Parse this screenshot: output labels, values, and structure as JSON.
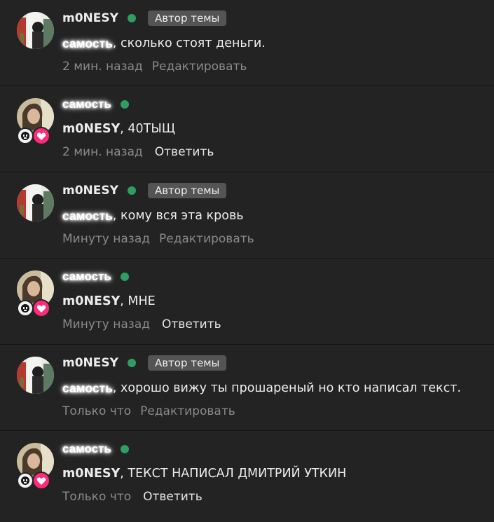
{
  "comments": [
    {
      "type": "author",
      "author": "m0NESY",
      "badge": "Автор темы",
      "mention": "самость",
      "text": ", сколько стоят деньги.",
      "time": "2 мин. назад",
      "action": "Редактировать"
    },
    {
      "type": "reply",
      "author": "самость",
      "mention": "m0NESY",
      "text": ", 40ТЫЩ",
      "time": "2 мин. назад",
      "action": "Ответить"
    },
    {
      "type": "author",
      "author": "m0NESY",
      "badge": "Автор темы",
      "mention": "самость",
      "text": ", кому вся эта кровь",
      "time": "Минуту назад",
      "action": "Редактировать"
    },
    {
      "type": "reply",
      "author": "самость",
      "mention": "m0NESY",
      "text": ", МНЕ",
      "time": "Минуту назад",
      "action": "Ответить"
    },
    {
      "type": "author",
      "author": "m0NESY",
      "badge": "Автор темы",
      "mention": "самость",
      "text": ", хорошо вижу ты прошареный но кто написал текст.",
      "time": "Только что",
      "action": "Редактировать"
    },
    {
      "type": "reply",
      "author": "самость",
      "mention": "m0NESY",
      "text": ", ТЕКСТ НАПИСАЛ ДМИТРИЙ УТКИН",
      "time": "Только что",
      "action": "Ответить"
    }
  ],
  "colors": {
    "background": "#232323",
    "online": "#2f9e62",
    "badge_bg": "#545454",
    "heart": "#ff2a7a"
  },
  "icons": {
    "online_indicator": "green-dot",
    "subscriber_badge_1": "face-mask-icon",
    "subscriber_badge_2": "heart-icon"
  }
}
